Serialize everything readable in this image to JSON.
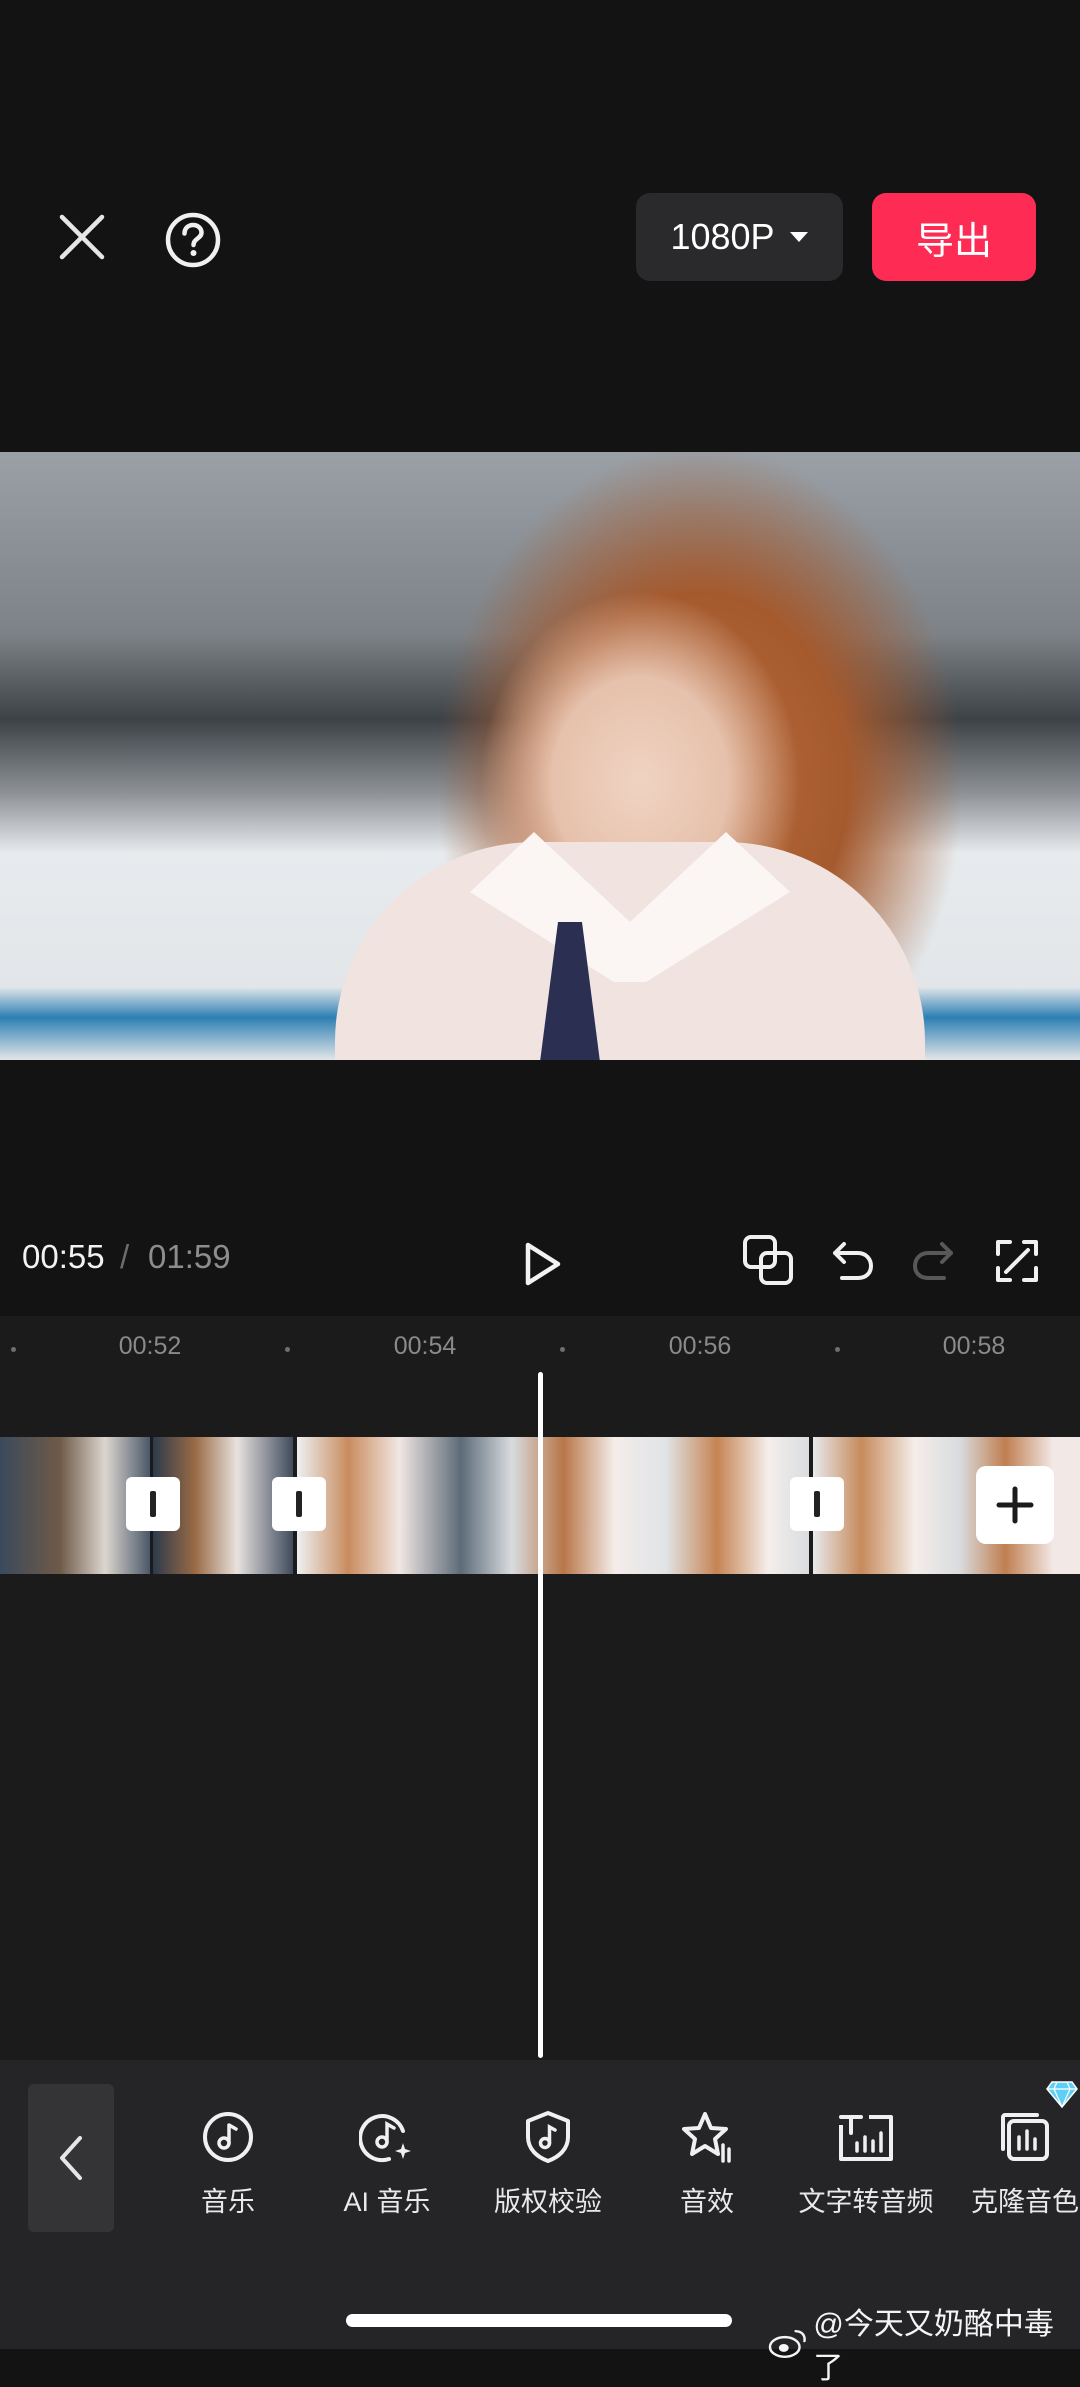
{
  "header": {
    "resolution_label": "1080P",
    "export_label": "导出"
  },
  "player": {
    "current_time": "00:55",
    "separator": "/",
    "total_time": "01:59"
  },
  "timeline": {
    "ruler_labels": [
      "00:52",
      "00:54",
      "00:56",
      "00:58"
    ]
  },
  "toolbar": {
    "items": [
      {
        "label": "音乐",
        "icon": "music-note-icon"
      },
      {
        "label": "AI 音乐",
        "icon": "ai-music-icon"
      },
      {
        "label": "版权校验",
        "icon": "copyright-shield-icon"
      },
      {
        "label": "音效",
        "icon": "sound-effect-star-icon"
      },
      {
        "label": "文字转音频",
        "icon": "text-to-audio-icon"
      },
      {
        "label": "克隆音色",
        "icon": "clone-voice-icon"
      }
    ]
  },
  "watermark": {
    "text": "@今天又奶酪中毒了"
  },
  "colors": {
    "accent": "#fe2c55",
    "background": "#131314",
    "timeline_bg": "#1b1b1c",
    "toolbar_bg": "#252527"
  }
}
